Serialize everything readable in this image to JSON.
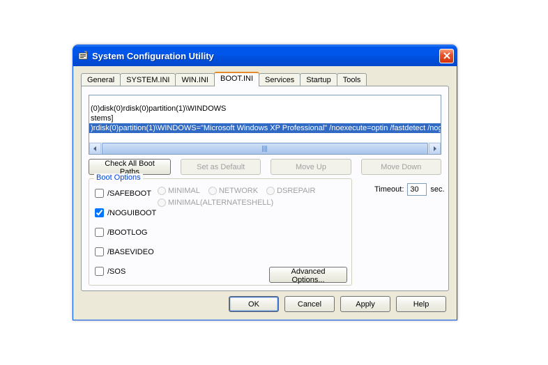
{
  "window": {
    "title": "System Configuration Utility"
  },
  "tabs": [
    {
      "label": "General"
    },
    {
      "label": "SYSTEM.INI"
    },
    {
      "label": "WIN.INI"
    },
    {
      "label": "BOOT.INI"
    },
    {
      "label": "Services"
    },
    {
      "label": "Startup"
    },
    {
      "label": "Tools"
    }
  ],
  "active_tab": 3,
  "listbox": {
    "lines": [
      "(0)disk(0)rdisk(0)partition(1)\\WINDOWS",
      "stems]",
      ")rdisk(0)partition(1)\\WINDOWS=\"Microsoft Windows XP Professional\" /noexecute=optin /fastdetect /noguiboot"
    ],
    "selected_index": 2
  },
  "buttons_row1": {
    "check_all": "Check All Boot Paths",
    "set_default": "Set as Default",
    "move_up": "Move Up",
    "move_down": "Move Down"
  },
  "boot_options": {
    "legend": "Boot Options",
    "safeboot": {
      "label": "/SAFEBOOT",
      "checked": false
    },
    "noguiboot": {
      "label": "/NOGUIBOOT",
      "checked": true
    },
    "bootlog": {
      "label": "/BOOTLOG",
      "checked": false
    },
    "basevideo": {
      "label": "/BASEVIDEO",
      "checked": false
    },
    "sos": {
      "label": "/SOS",
      "checked": false
    },
    "radios": {
      "minimal": "MINIMAL",
      "network": "NETWORK",
      "dsrepair": "DSREPAIR",
      "minimal_alt": "MINIMAL(ALTERNATESHELL)"
    },
    "advanced": "Advanced Options..."
  },
  "timeout": {
    "label": "Timeout:",
    "value": "30",
    "unit": "sec."
  },
  "bottom": {
    "ok": "OK",
    "cancel": "Cancel",
    "apply": "Apply",
    "help": "Help"
  }
}
